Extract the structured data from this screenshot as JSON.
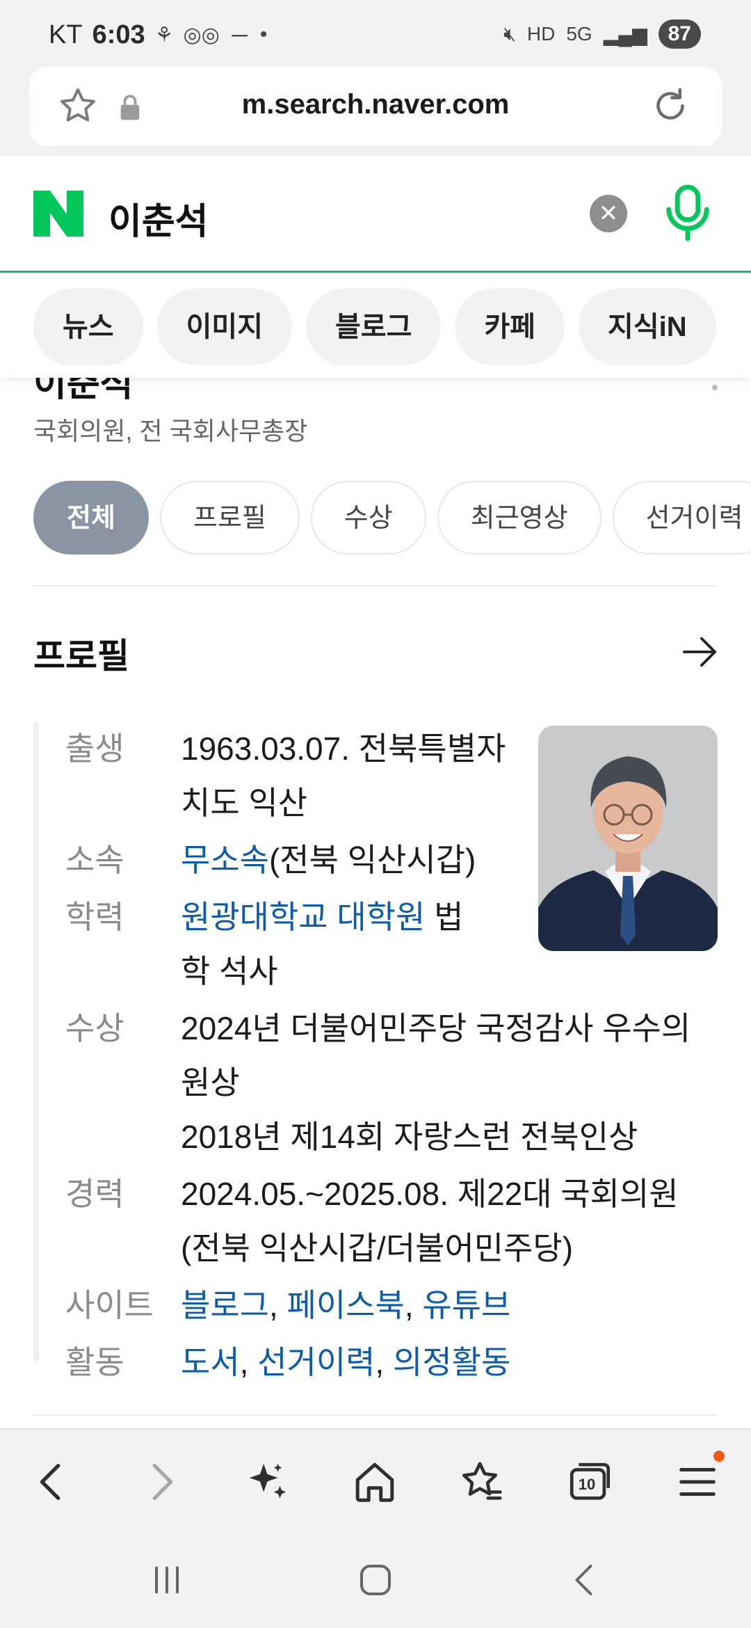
{
  "status_bar": {
    "carrier": "KT",
    "time": "6:03",
    "battery": "87"
  },
  "browser": {
    "url": "m.search.naver.com"
  },
  "search": {
    "query": "이춘석"
  },
  "tabs": [
    "뉴스",
    "이미지",
    "블로그",
    "카페",
    "지식iN"
  ],
  "person": {
    "name": "이춘석",
    "subtitle": "국회의원, 전 국회사무총장"
  },
  "chips": [
    "전체",
    "프로필",
    "수상",
    "최근영상",
    "선거이력"
  ],
  "profile": {
    "title": "프로필",
    "birth": {
      "label": "출생",
      "value": "1963.03.07. 전북특별자치도 익산"
    },
    "affiliation": {
      "label": "소속",
      "link": "무소속",
      "rest": "(전북 익산시갑)"
    },
    "education": {
      "label": "학력",
      "link": "원광대학교 대학원",
      "rest": " 법학 석사"
    },
    "awards": {
      "label": "수상",
      "items": [
        "2024년 더불어민주당 국정감사 우수의원상",
        "2018년 제14회 자랑스런 전북인상"
      ]
    },
    "career": {
      "label": "경력",
      "value": "2024.05.~2025.08. 제22대 국회의원 (전북 익산시갑/더불어민주당)"
    },
    "sites": {
      "label": "사이트",
      "links": [
        "블로그",
        "페이스북",
        "유튜브"
      ],
      "sep": ", "
    },
    "activity": {
      "label": "활동",
      "links": [
        "도서",
        "선거이력",
        "의정활동"
      ],
      "sep": ", "
    }
  },
  "toolbar": {
    "tabs_count": "10"
  },
  "colors": {
    "naver_green": "#03c75a",
    "link_blue": "#0b5cad",
    "chip_active": "#8a94a3",
    "notification": "#f25a14"
  }
}
